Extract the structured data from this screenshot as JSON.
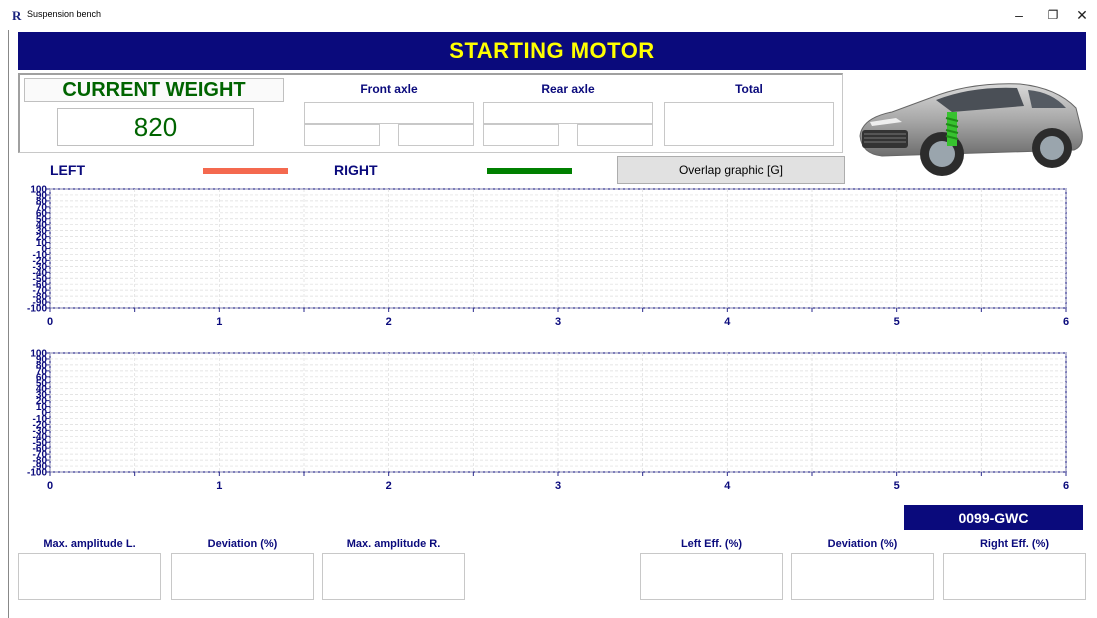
{
  "window": {
    "logo": "R",
    "title": "Suspension bench",
    "minimize_glyph": "–",
    "restore_glyph": "❐",
    "close_glyph": "✕"
  },
  "banner": {
    "text": "STARTING MOTOR",
    "bg": "#0a0a7c",
    "fg": "#ffff00"
  },
  "weight": {
    "label": "CURRENT WEIGHT",
    "value": "820",
    "front_axle_label": "Front axle",
    "rear_axle_label": "Rear axle",
    "total_label": "Total"
  },
  "legend": {
    "left_label": "LEFT",
    "left_color": "#f4694f",
    "right_label": "RIGHT",
    "right_color": "#008000",
    "overlap_button": "Overlap graphic [G]"
  },
  "car_image_icon": "car-cutaway-suspension-icon",
  "chart_data": [
    {
      "type": "line",
      "x_ticks": [
        "0",
        "1",
        "2",
        "3",
        "4",
        "5",
        "6"
      ],
      "y_ticks": [
        "100",
        "90",
        "80",
        "70",
        "60",
        "50",
        "40",
        "30",
        "20",
        "10",
        "0",
        "-10",
        "-20",
        "-30",
        "-40",
        "-50",
        "-60",
        "-70",
        "-80",
        "-90",
        "-100"
      ],
      "xlim": [
        0,
        6
      ],
      "ylim": [
        -100,
        100
      ],
      "grid": true,
      "series": []
    },
    {
      "type": "line",
      "x_ticks": [
        "0",
        "1",
        "2",
        "3",
        "4",
        "5",
        "6"
      ],
      "y_ticks": [
        "100",
        "90",
        "80",
        "70",
        "60",
        "50",
        "40",
        "30",
        "20",
        "10",
        "0",
        "-10",
        "-20",
        "-30",
        "-40",
        "-50",
        "-60",
        "-70",
        "-80",
        "-90",
        "-100"
      ],
      "xlim": [
        0,
        6
      ],
      "ylim": [
        -100,
        100
      ],
      "grid": true,
      "series": []
    }
  ],
  "plate": "0099-GWC",
  "stats": {
    "max_amp_left": "Max. amplitude L.",
    "deviation_left": "Deviation (%)",
    "max_amp_right": "Max. amplitude R.",
    "left_eff": "Left Eff. (%)",
    "deviation_right": "Deviation (%)",
    "right_eff": "Right Eff. (%)"
  }
}
